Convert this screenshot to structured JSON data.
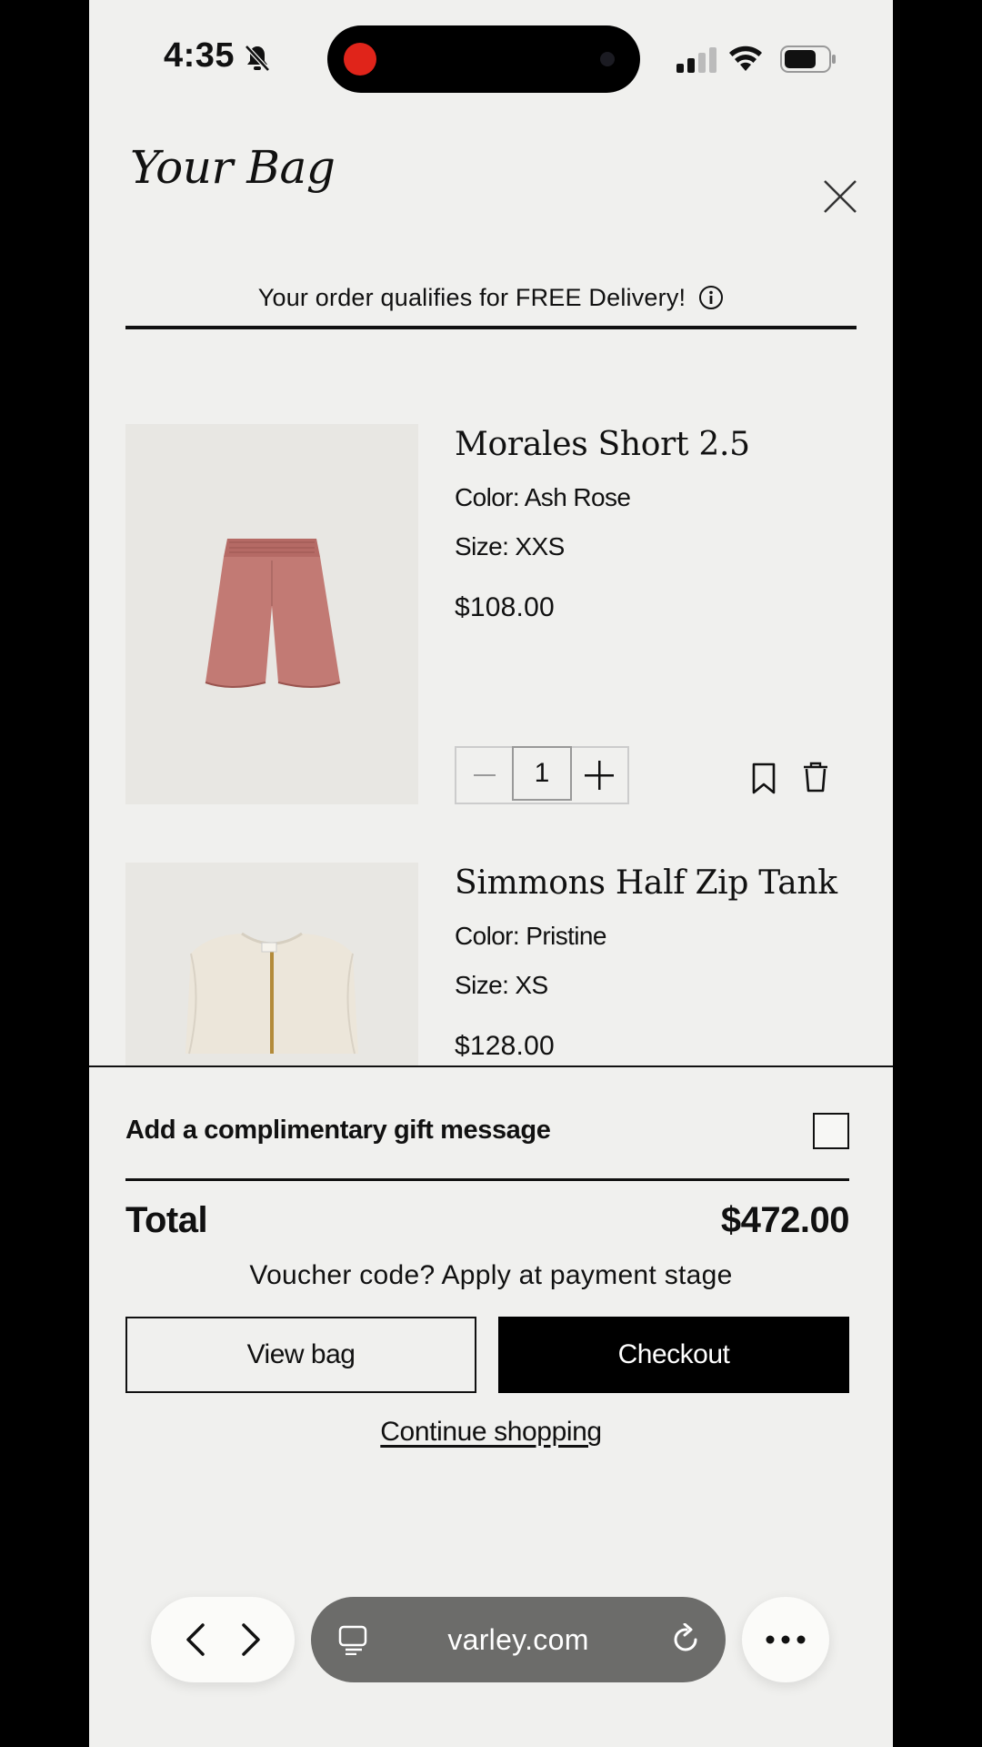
{
  "status_bar": {
    "time": "4:35"
  },
  "header": {
    "title": "Your Bag"
  },
  "delivery_banner": {
    "text": "Your order qualifies for FREE Delivery!"
  },
  "products": [
    {
      "name": "Morales Short 2.5",
      "color": "Color: Ash Rose",
      "size": "Size: XXS",
      "price": "$108.00",
      "quantity": "1",
      "image_color": "#c27a74"
    },
    {
      "name": "Simmons Half Zip Tank",
      "color": "Color: Pristine",
      "size": "Size: XS",
      "price": "$128.00",
      "image_color": "#ece6da"
    }
  ],
  "checkout": {
    "gift_label": "Add a complimentary gift message",
    "gift_checked": false,
    "total_label": "Total",
    "total_value": "$472.00",
    "voucher_text": "Voucher code? Apply at payment stage",
    "view_bag_label": "View bag",
    "checkout_label": "Checkout",
    "continue_label": "Continue shopping"
  },
  "browser": {
    "url": "varley.com"
  },
  "colors": {
    "background": "#f0f0ee",
    "primary": "#000000",
    "record": "#e0241a"
  }
}
